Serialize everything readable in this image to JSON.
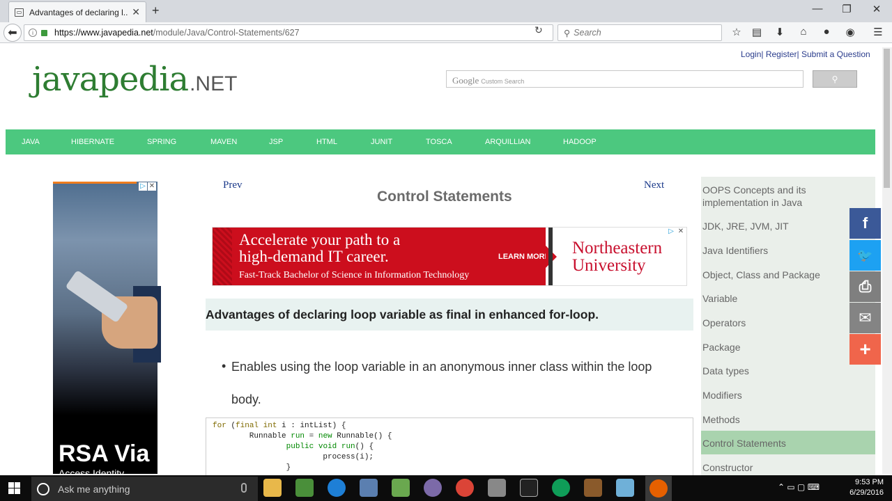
{
  "browser": {
    "tab_title": "Advantages of declaring l...",
    "tab_close": "✕",
    "new_tab": "+",
    "url_host": "https://www.javapedia.net",
    "url_path": "/module/Java/Control-Statements/627",
    "search_placeholder": "Search",
    "window_controls": [
      "—",
      "❐",
      "✕"
    ],
    "toolbar_icons": [
      "star-icon",
      "reading-list-icon",
      "download-icon",
      "home-icon",
      "chat-icon",
      "pocket-icon",
      "menu-icon"
    ]
  },
  "page": {
    "top_links": [
      "Login",
      "Register",
      "Submit a Question"
    ],
    "logo_main": "javapedia",
    "logo_suffix": ".NET",
    "google_label": "Google",
    "google_sub": "Custom Search",
    "menu": [
      "JAVA",
      "HIBERNATE",
      "SPRING",
      "MAVEN",
      "JSP",
      "HTML",
      "JUNIT",
      "TOSCA",
      "ARQUILLIAN",
      "HADOOP"
    ],
    "prev": "Prev",
    "next": "Next",
    "title": "Control Statements",
    "banner": {
      "headline1": "Accelerate your path to a",
      "headline2": "high-demand IT career.",
      "sub": "Fast-Track Bachelor of Science in Information Technology",
      "cta": "LEARN MORE",
      "brand1": "Northeastern",
      "brand2": "University"
    },
    "question": "Advantages of declaring loop variable as final in enhanced for-loop.",
    "bullet_text": "Enables using the loop variable in an anonymous inner class within the loop body.",
    "code_lines": [
      "for (final int i : intList) {",
      "        Runnable run = new Runnable() {",
      "                public void run() {",
      "                        process(i);",
      "                }"
    ],
    "left_ad": {
      "title": "RSA Via",
      "subtitle": "Access Identity"
    }
  },
  "sidebar": {
    "items": [
      "OOPS Concepts and its implementation in Java",
      "JDK, JRE, JVM, JIT",
      "Java Identifiers",
      "Object, Class and Package",
      "Variable",
      "Operators",
      "Package",
      "Data types",
      "Modifiers",
      "Methods",
      "Control Statements",
      "Constructor"
    ],
    "active": "Control Statements"
  },
  "share": {
    "buttons": [
      {
        "icon": "facebook-icon",
        "glyph": "f",
        "color": "#3b5998"
      },
      {
        "icon": "twitter-icon",
        "glyph": "🐦",
        "color": "#1da1f2"
      },
      {
        "icon": "print-icon",
        "glyph": "⎙",
        "color": "#7f7f7f"
      },
      {
        "icon": "email-icon",
        "glyph": "✉",
        "color": "#848484"
      },
      {
        "icon": "plus-icon",
        "glyph": "+",
        "color": "#f0654b"
      }
    ]
  },
  "taskbar": {
    "search_text": "Ask me anything",
    "time": "9:53 PM",
    "date": "6/29/2016"
  }
}
